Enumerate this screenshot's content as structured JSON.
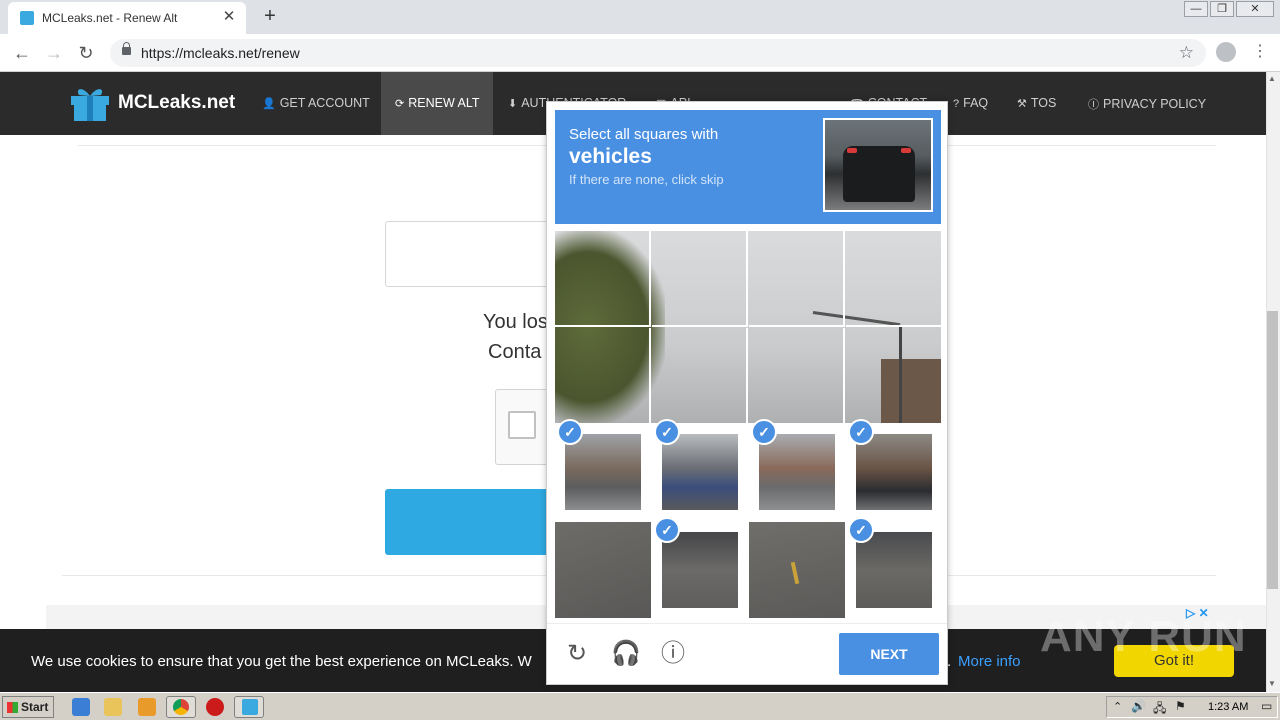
{
  "browser": {
    "tab_title": "MCLeaks.net - Renew Alt",
    "close_tab": "✕",
    "new_tab": "+",
    "url": "https://mcleaks.net/renew",
    "window_buttons": [
      "—",
      "❐",
      "✕"
    ]
  },
  "site": {
    "logo_text": "MCLeaks.net",
    "nav": [
      {
        "label": "GET ACCOUNT",
        "icon": "user-plus-icon"
      },
      {
        "label": "RENEW ALT",
        "icon": "refresh-icon"
      },
      {
        "label": "AUTHENTICATOR",
        "icon": "download-icon"
      },
      {
        "label": "API",
        "icon": "code-icon"
      },
      {
        "label": "CONTACT",
        "icon": "phone-icon"
      },
      {
        "label": "FAQ",
        "icon": "question-icon"
      },
      {
        "label": "TOS",
        "icon": "gavel-icon"
      },
      {
        "label": "PRIVACY POLICY",
        "icon": "info-icon"
      }
    ],
    "content_line1": "You los",
    "content_line2": "Conta"
  },
  "captcha": {
    "prompt": "Select all squares with",
    "object": "vehicles",
    "hint": "If there are none, click skip",
    "check": "✓",
    "next_label": "NEXT",
    "colors": {
      "accent": "#4a90e2"
    }
  },
  "cookie": {
    "text": "We use cookies to ensure that you get the best experience on MCLeaks. W",
    "tail": ".",
    "more_label": "More info",
    "accept_label": "Got it!"
  },
  "watermark": "ANY RUN",
  "taskbar": {
    "start_label": "Start",
    "clock": "1:23 AM"
  }
}
